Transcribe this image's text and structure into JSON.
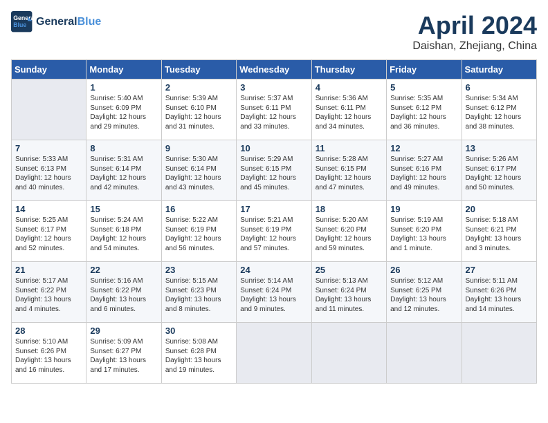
{
  "header": {
    "logo_line1": "General",
    "logo_line2": "Blue",
    "month_year": "April 2024",
    "location": "Daishan, Zhejiang, China"
  },
  "days_of_week": [
    "Sunday",
    "Monday",
    "Tuesday",
    "Wednesday",
    "Thursday",
    "Friday",
    "Saturday"
  ],
  "weeks": [
    [
      {
        "num": "",
        "info": ""
      },
      {
        "num": "1",
        "info": "Sunrise: 5:40 AM\nSunset: 6:09 PM\nDaylight: 12 hours\nand 29 minutes."
      },
      {
        "num": "2",
        "info": "Sunrise: 5:39 AM\nSunset: 6:10 PM\nDaylight: 12 hours\nand 31 minutes."
      },
      {
        "num": "3",
        "info": "Sunrise: 5:37 AM\nSunset: 6:11 PM\nDaylight: 12 hours\nand 33 minutes."
      },
      {
        "num": "4",
        "info": "Sunrise: 5:36 AM\nSunset: 6:11 PM\nDaylight: 12 hours\nand 34 minutes."
      },
      {
        "num": "5",
        "info": "Sunrise: 5:35 AM\nSunset: 6:12 PM\nDaylight: 12 hours\nand 36 minutes."
      },
      {
        "num": "6",
        "info": "Sunrise: 5:34 AM\nSunset: 6:12 PM\nDaylight: 12 hours\nand 38 minutes."
      }
    ],
    [
      {
        "num": "7",
        "info": "Sunrise: 5:33 AM\nSunset: 6:13 PM\nDaylight: 12 hours\nand 40 minutes."
      },
      {
        "num": "8",
        "info": "Sunrise: 5:31 AM\nSunset: 6:14 PM\nDaylight: 12 hours\nand 42 minutes."
      },
      {
        "num": "9",
        "info": "Sunrise: 5:30 AM\nSunset: 6:14 PM\nDaylight: 12 hours\nand 43 minutes."
      },
      {
        "num": "10",
        "info": "Sunrise: 5:29 AM\nSunset: 6:15 PM\nDaylight: 12 hours\nand 45 minutes."
      },
      {
        "num": "11",
        "info": "Sunrise: 5:28 AM\nSunset: 6:15 PM\nDaylight: 12 hours\nand 47 minutes."
      },
      {
        "num": "12",
        "info": "Sunrise: 5:27 AM\nSunset: 6:16 PM\nDaylight: 12 hours\nand 49 minutes."
      },
      {
        "num": "13",
        "info": "Sunrise: 5:26 AM\nSunset: 6:17 PM\nDaylight: 12 hours\nand 50 minutes."
      }
    ],
    [
      {
        "num": "14",
        "info": "Sunrise: 5:25 AM\nSunset: 6:17 PM\nDaylight: 12 hours\nand 52 minutes."
      },
      {
        "num": "15",
        "info": "Sunrise: 5:24 AM\nSunset: 6:18 PM\nDaylight: 12 hours\nand 54 minutes."
      },
      {
        "num": "16",
        "info": "Sunrise: 5:22 AM\nSunset: 6:19 PM\nDaylight: 12 hours\nand 56 minutes."
      },
      {
        "num": "17",
        "info": "Sunrise: 5:21 AM\nSunset: 6:19 PM\nDaylight: 12 hours\nand 57 minutes."
      },
      {
        "num": "18",
        "info": "Sunrise: 5:20 AM\nSunset: 6:20 PM\nDaylight: 12 hours\nand 59 minutes."
      },
      {
        "num": "19",
        "info": "Sunrise: 5:19 AM\nSunset: 6:20 PM\nDaylight: 13 hours\nand 1 minute."
      },
      {
        "num": "20",
        "info": "Sunrise: 5:18 AM\nSunset: 6:21 PM\nDaylight: 13 hours\nand 3 minutes."
      }
    ],
    [
      {
        "num": "21",
        "info": "Sunrise: 5:17 AM\nSunset: 6:22 PM\nDaylight: 13 hours\nand 4 minutes."
      },
      {
        "num": "22",
        "info": "Sunrise: 5:16 AM\nSunset: 6:22 PM\nDaylight: 13 hours\nand 6 minutes."
      },
      {
        "num": "23",
        "info": "Sunrise: 5:15 AM\nSunset: 6:23 PM\nDaylight: 13 hours\nand 8 minutes."
      },
      {
        "num": "24",
        "info": "Sunrise: 5:14 AM\nSunset: 6:24 PM\nDaylight: 13 hours\nand 9 minutes."
      },
      {
        "num": "25",
        "info": "Sunrise: 5:13 AM\nSunset: 6:24 PM\nDaylight: 13 hours\nand 11 minutes."
      },
      {
        "num": "26",
        "info": "Sunrise: 5:12 AM\nSunset: 6:25 PM\nDaylight: 13 hours\nand 12 minutes."
      },
      {
        "num": "27",
        "info": "Sunrise: 5:11 AM\nSunset: 6:26 PM\nDaylight: 13 hours\nand 14 minutes."
      }
    ],
    [
      {
        "num": "28",
        "info": "Sunrise: 5:10 AM\nSunset: 6:26 PM\nDaylight: 13 hours\nand 16 minutes."
      },
      {
        "num": "29",
        "info": "Sunrise: 5:09 AM\nSunset: 6:27 PM\nDaylight: 13 hours\nand 17 minutes."
      },
      {
        "num": "30",
        "info": "Sunrise: 5:08 AM\nSunset: 6:28 PM\nDaylight: 13 hours\nand 19 minutes."
      },
      {
        "num": "",
        "info": ""
      },
      {
        "num": "",
        "info": ""
      },
      {
        "num": "",
        "info": ""
      },
      {
        "num": "",
        "info": ""
      }
    ]
  ]
}
